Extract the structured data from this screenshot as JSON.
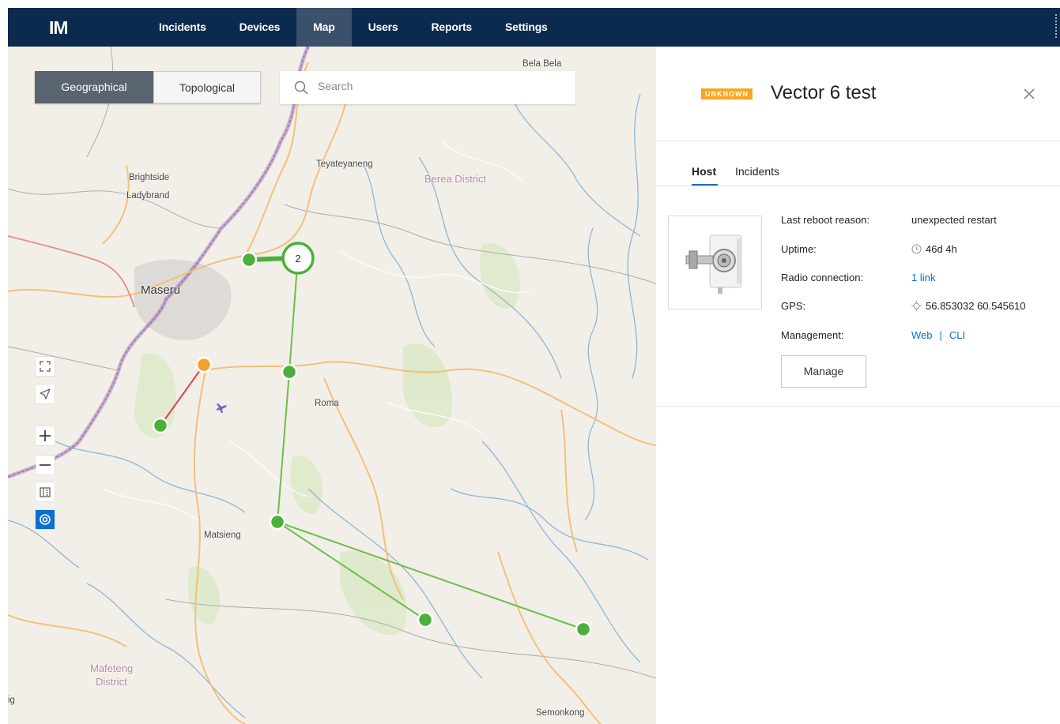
{
  "app": {
    "logo": "IM"
  },
  "nav": {
    "items": [
      "Incidents",
      "Devices",
      "Map",
      "Users",
      "Reports",
      "Settings"
    ],
    "active": "Map"
  },
  "map": {
    "view_toggle": {
      "geographical": "Geographical",
      "topological": "Topological",
      "active": "Geographical"
    },
    "search": {
      "placeholder": "Search"
    },
    "labels": {
      "bela_bela": "Bela Bela",
      "teyateyaneng": "Teyateyaneng",
      "berea_district": "Berea District",
      "brightside": "Brightside",
      "ladybrand": "Ladybrand",
      "maseru": "Maseru",
      "roma": "Roma",
      "matsieng": "Matsieng",
      "mafeteng": "Mafeteng",
      "district": "District",
      "semonkong": "Semonkong",
      "edge_ig": "ig"
    },
    "cluster_count": "2",
    "colors": {
      "node_ok": "#4caf3c",
      "node_warn": "#f5a02c",
      "link_ok": "#6cbf4a",
      "link_bad": "#e53d4b"
    }
  },
  "panel": {
    "status_badge": "UNKNOWN",
    "title": "Vector 6 test",
    "tabs": [
      "Host",
      "Incidents"
    ],
    "active_tab": "Host",
    "props": {
      "last_reboot_label": "Last reboot reason:",
      "last_reboot_value": "unexpected restart",
      "uptime_label": "Uptime:",
      "uptime_value": "46d 4h",
      "radio_label": "Radio connection:",
      "radio_value": "1 link",
      "gps_label": "GPS:",
      "gps_value": "56.853032 60.545610",
      "management_label": "Management:",
      "management_web": "Web",
      "management_sep": "|",
      "management_cli": "CLI"
    },
    "manage_button": "Manage"
  }
}
